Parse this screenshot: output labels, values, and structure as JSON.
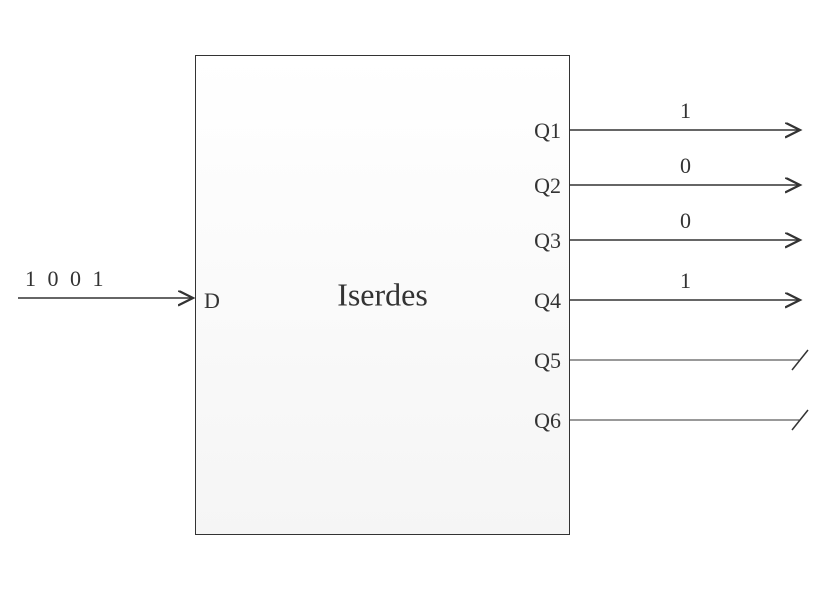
{
  "block": {
    "title": "Iserdes",
    "input_port": "D",
    "output_ports": [
      "Q1",
      "Q2",
      "Q3",
      "Q4",
      "Q5",
      "Q6"
    ]
  },
  "input": {
    "value": "1 0 0 1"
  },
  "outputs": {
    "q1": "1",
    "q2": "0",
    "q3": "0",
    "q4": "1"
  }
}
